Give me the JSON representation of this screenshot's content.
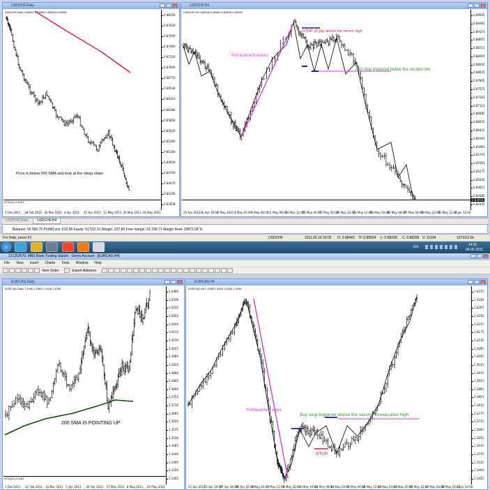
{
  "colors": {
    "titlebar": "#8fb0e8",
    "taskbar": "#1f4a6e",
    "red": "#d81e3c",
    "magenta": "#d63ad8",
    "blue": "#1515e0",
    "green": "#2a9a2a",
    "darkgreen": "#0c4a0c"
  },
  "top_window": {
    "daily": {
      "title": "USDCHF,Daily",
      "header": "USDCHF,Daily 0.84842 0.85089 0.83505 0.83958",
      "ticks": [
        "0.88150",
        "0.87920",
        "0.87690",
        "0.87460",
        "0.87230",
        "0.87000",
        "0.86770",
        "0.86540",
        "0.86310",
        "0.86080",
        "0.85850",
        "0.85620",
        "0.85390",
        "0.85160",
        "0.84930",
        "0.84700",
        "0.84470",
        "0.84240",
        "0.83958"
      ],
      "annotation": "Price is below 200 SMA and look at the steep slope",
      "atr_label": "ATR(14) 0.0091",
      "dates": [
        "1 Feb 2011",
        "28 Feb 2011",
        "16 Mar 2011",
        "4 Apr 2011",
        "21 Apr 2011",
        "11 May 2011",
        "30 May 2011",
        "16 May 2011"
      ]
    },
    "h4": {
      "title": "USDCHF,H4",
      "header": "USDCHF,H4 0.84842 0.85089 0.83505 0.83958",
      "ticks": [
        "0.89665",
        "0.89465",
        "0.89175",
        "0.88955",
        "0.88725",
        "0.88495",
        "0.88265",
        "0.88035",
        "0.87805",
        "0.87575",
        "0.87345",
        "0.87115",
        "0.86885",
        "0.86655",
        "0.86425",
        "0.86195",
        "0.85965",
        "0.85735",
        "0.85505",
        "0.85275",
        "0.85045",
        "0.84815",
        "0.84585",
        "0.84355"
      ],
      "last": "0.83958",
      "stop_label": "STOP 20 pip above the recent high",
      "retracement_label": "Retracement waves",
      "sell_label": "Sell stop triggered below the second low",
      "dates": [
        "25 Apr 2011",
        "26 Apr 16:00",
        "2 May 2011",
        "4 May 20:00",
        "9 May 08:00",
        "11 May 08:00",
        "13 May 12:00",
        "16 May 00:00",
        "17 May 16:00",
        "19 May 12:00",
        "23 May 12:00",
        "24 May 16:00",
        "26 May 08:00",
        "27 May 04:00",
        "29 May 20:00",
        "31 May 12:00",
        "2 Jun 12:00"
      ]
    },
    "tab": "USDCHF,Daily",
    "tab2": "USDCHF,H4",
    "account_line": "Balance: 50 965.75  Profit/Loss: 516.56  Equity: 51 512.31  Margin: 237.80  Free margin: 51 296.71  Margin level: 23872.04 %",
    "status": {
      "help": "For Help, press F1",
      "symbol": "USDCHF",
      "time": "2011.05.16 20:00",
      "o": "O: 0.88443",
      "h": "H: 0.88504",
      "l": "L: 0.88299",
      "c": "C: 0.88299",
      "v": "V: 11334",
      "conn": "10731/2 kb"
    }
  },
  "taskbar": {
    "time": "14:11",
    "date": "06-06-2011",
    "lang": "EN"
  },
  "bottom_window": {
    "title": "121252670: MBS Bank Trading Station - Demo Account - [EURCAD,H4]",
    "menu": [
      "File",
      "View",
      "Insert",
      "Charts",
      "Tools",
      "Window",
      "Help"
    ],
    "toolbar": {
      "new_order": "New Order",
      "advisors": "Expert Advisors"
    },
    "daily": {
      "title": "EURCAD,Daily",
      "header": "EURCAD,Daily 1.4296 1.4363 1.4248 1.4339",
      "ticks": [
        "1.4380",
        "1.4339",
        "1.4250",
        "1.4205",
        "1.4160",
        "1.4115",
        "1.4070",
        "1.4025",
        "1.3980",
        "1.3935",
        "1.3890",
        "1.3845",
        "1.3800",
        "1.3755",
        "1.3710",
        "1.3665",
        "1.3620",
        "1.3575",
        "1.3530",
        "1.3485",
        "1.3440",
        "1.3395",
        "1.3350",
        "1.3305"
      ],
      "annotation": "200 SMA IS POINTING UP",
      "atr_label": "ATR(14) 0.0154",
      "dates": [
        "1 Feb 2011",
        "22 Feb 2011",
        "15 Mar 2011",
        "5 Apr 2011",
        "26 Apr 2011",
        "17 May 2011",
        "8 May 2011",
        "26 May 2011"
      ]
    },
    "h4": {
      "title": "EURCAD,H4",
      "header": "EURCAD,H4 1.4208 1.4363 1.4204 1.4339",
      "ticks": [
        "1.4375",
        "1.4339",
        "1.4295",
        "1.4255",
        "1.4215",
        "1.4175",
        "1.4135",
        "1.4095",
        "1.4055",
        "1.4015",
        "1.3975",
        "1.3935",
        "1.3895",
        "1.3855",
        "1.3815",
        "1.3775",
        "1.3735",
        "1.3695",
        "1.3655",
        "1.3615",
        "1.3575",
        "1.3535",
        "1.3495",
        "1.3455"
      ],
      "retracement_label": "Retracement wave",
      "buy_label": "Buy stop triggered above the second consecutive high",
      "stop_label": "STOP",
      "dates": [
        "21 Apr 2011",
        "25 Apr 20:00",
        "27 Apr 04:00",
        "29 Apr 20:00",
        "3 May 20:00",
        "5 May 12:00",
        "6 May 20:00",
        "10 May 16:00",
        "12 May 08:00",
        "13 May 20:00",
        "17 May 04:00",
        "18 May 12:00",
        "20 May 04:00",
        "23 May 20:00",
        "25 May 12:00",
        "27 May 04:00",
        "30 May 20:00",
        "1 Jun 16:00"
      ]
    }
  }
}
